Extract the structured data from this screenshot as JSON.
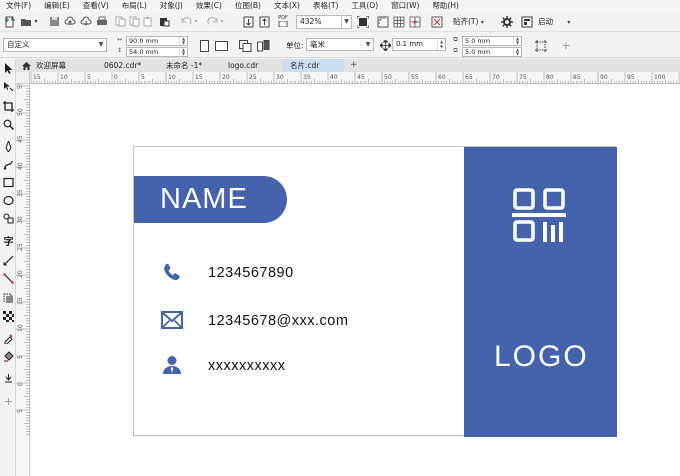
{
  "menu": [
    "文件(F)",
    "编辑(E)",
    "查看(V)",
    "布局(L)",
    "对象(J)",
    "效果(C)",
    "位图(B)",
    "文本(X)",
    "表格(T)",
    "工具(O)",
    "窗口(W)",
    "帮助(H)"
  ],
  "toolbar": {
    "zoom_value": "432%",
    "export_format": "PDF",
    "snap_label": "贴齐(T)",
    "launch_label": "启动"
  },
  "property_bar": {
    "preset": "自定义",
    "width": "90.0 mm",
    "height": "54.0 mm",
    "unit_label": "单位:",
    "unit_value": "毫米",
    "nudge": "0.1 mm",
    "dup_x": "5.0 mm",
    "dup_y": "5.0 mm"
  },
  "tabs": [
    {
      "label": "欢迎屏幕",
      "active": false
    },
    {
      "label": "0602.cdr*",
      "active": false
    },
    {
      "label": "未命名 -1*",
      "active": false
    },
    {
      "label": "logo.cdr",
      "active": false
    },
    {
      "label": "名片.cdr",
      "active": true
    }
  ],
  "ruler_h_labels": [
    "15",
    "10",
    "5",
    "0",
    "5",
    "10",
    "15",
    "20",
    "25",
    "30",
    "35",
    "40",
    "45",
    "50",
    "55",
    "60",
    "65",
    "70",
    "75",
    "80",
    "85",
    "90",
    "95",
    "100",
    "105"
  ],
  "ruler_v_labels": [
    "55",
    "50",
    "45",
    "40",
    "35",
    "30",
    "25",
    "20",
    "15",
    "10",
    "5",
    "0",
    "5"
  ],
  "card": {
    "name": "NAME",
    "phone": "1234567890",
    "email": "12345678@xxx.com",
    "person": "xxxxxxxxxx",
    "logo": "LOGO",
    "accent_color": "#4563ad"
  }
}
